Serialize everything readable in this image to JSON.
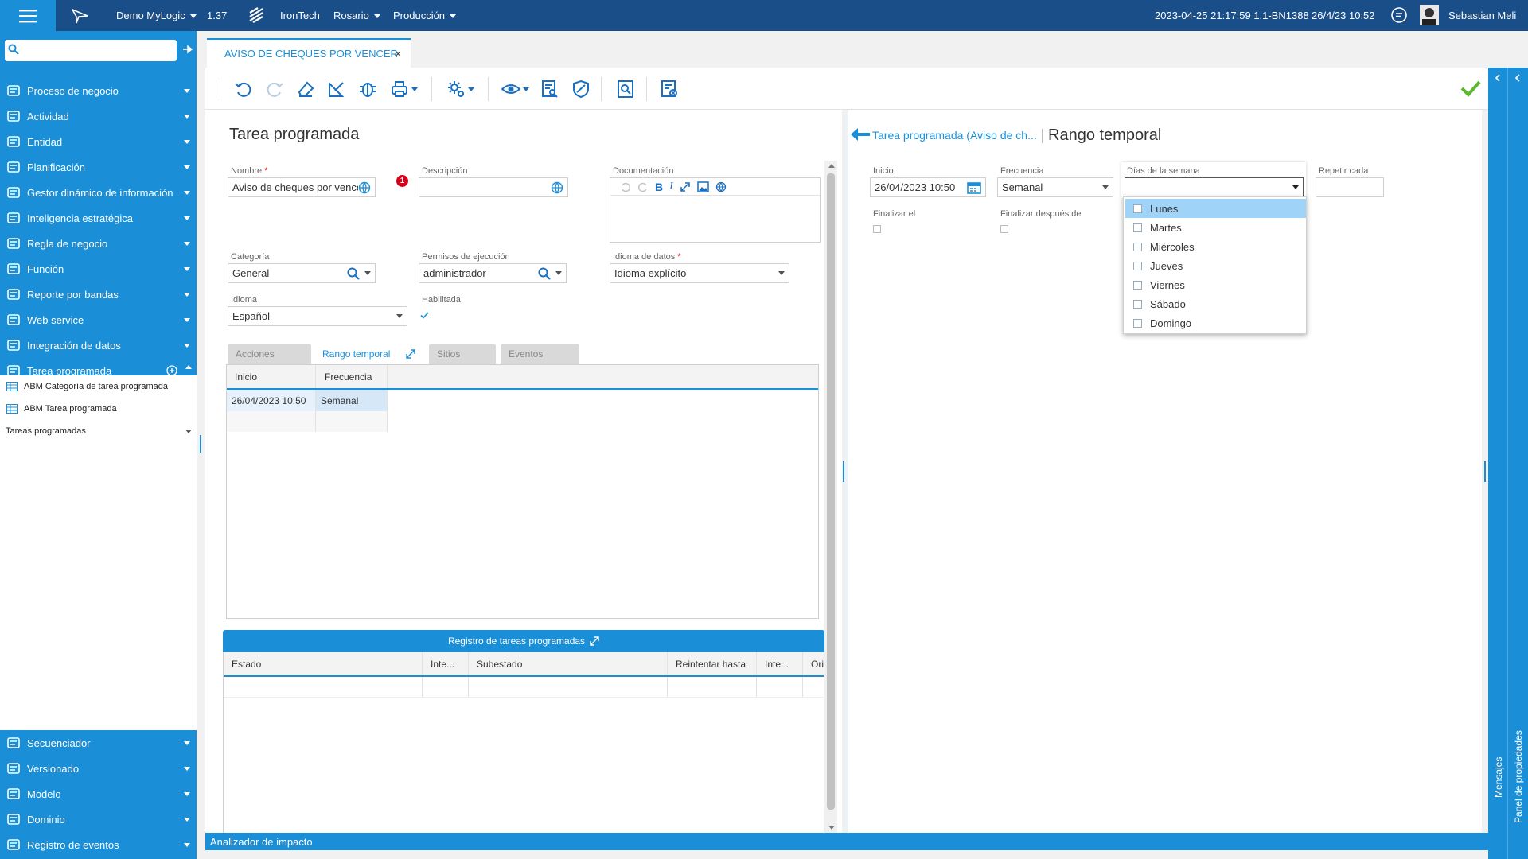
{
  "topbar": {
    "app_name": "Demo MyLogic",
    "version": "1.37",
    "company": "IronTech",
    "location": "Rosario",
    "environment": "Producción",
    "build": "2023-04-25 21:17:59 1.1-BN1388",
    "date": "26/4/23 10:52",
    "user": "Sebastian Meli"
  },
  "sidebar": {
    "search_placeholder": "",
    "items": [
      {
        "label": "Proceso de negocio",
        "icon": "process-icon"
      },
      {
        "label": "Actividad",
        "icon": "activity-icon"
      },
      {
        "label": "Entidad",
        "icon": "entity-icon"
      },
      {
        "label": "Planificación",
        "icon": "calendar-icon"
      },
      {
        "label": "Gestor dinámico de información",
        "icon": "gauge-icon"
      },
      {
        "label": "Inteligencia estratégica",
        "icon": "network-icon"
      },
      {
        "label": "Regla de negocio",
        "icon": "rule-icon"
      },
      {
        "label": "Función",
        "icon": "function-icon"
      },
      {
        "label": "Reporte por bandas",
        "icon": "report-icon"
      },
      {
        "label": "Web service",
        "icon": "cloud-icon"
      },
      {
        "label": "Integración de datos",
        "icon": "integration-icon"
      },
      {
        "label": "Tarea programada",
        "icon": "clock-icon"
      }
    ],
    "sub_items": [
      "ABM Categoría de tarea programada",
      "ABM Tarea programada",
      "Tareas programadas"
    ],
    "bottom_items": [
      "Secuenciador",
      "Versionado",
      "Modelo",
      "Dominio",
      "Registro de eventos"
    ]
  },
  "doc_tab": {
    "label": "AVISO DE CHEQUES POR VENCER",
    "close": "×"
  },
  "form": {
    "title": "Tarea programada",
    "nombre": {
      "label": "Nombre",
      "value": "Aviso de cheques por vencer",
      "badge": "1"
    },
    "descripcion": {
      "label": "Descripción",
      "value": ""
    },
    "documentacion": {
      "label": "Documentación"
    },
    "categoria": {
      "label": "Categoría",
      "value": "General"
    },
    "permisos": {
      "label": "Permisos de ejecución",
      "value": "administrador"
    },
    "idioma_datos": {
      "label": "Idioma de datos",
      "value": "Idioma explícito"
    },
    "idioma": {
      "label": "Idioma",
      "value": "Español"
    },
    "habilitada": {
      "label": "Habilitada",
      "checked": true
    },
    "tabs": [
      "Acciones",
      "Rango temporal",
      "Sitios",
      "Eventos"
    ],
    "grid": {
      "columns": [
        "Inicio",
        "Frecuencia"
      ],
      "rows": [
        [
          "26/04/2023 10:50",
          "Semanal"
        ]
      ]
    },
    "registro": {
      "title": "Registro de tareas programadas",
      "columns": [
        "Estado",
        "Inte...",
        "Subestado",
        "Reintentar hasta",
        "Inte...",
        "Ori"
      ]
    }
  },
  "right": {
    "breadcrumb": "Tarea programada (Aviso de ch...",
    "title": "Rango temporal",
    "inicio": {
      "label": "Inicio",
      "value": "26/04/2023 10:50"
    },
    "frecuencia": {
      "label": "Frecuencia",
      "value": "Semanal"
    },
    "dias": {
      "label": "Días de la semana",
      "value": ""
    },
    "repetir": {
      "label": "Repetir cada",
      "value": ""
    },
    "finalizar_el": {
      "label": "Finalizar el"
    },
    "finalizar_despues": {
      "label": "Finalizar después de"
    },
    "dropdown": [
      "Lunes",
      "Martes",
      "Miércoles",
      "Jueves",
      "Viernes",
      "Sábado",
      "Domingo"
    ]
  },
  "rightstrip": {
    "properties": "Panel de propiedades",
    "messages": "Mensajes"
  },
  "bottombar": {
    "label": "Analizador de impacto"
  },
  "colors": {
    "primary": "#1a8fd8",
    "topbar": "#1a4e88",
    "badge": "#d9001b",
    "ok": "#5cb82e"
  }
}
